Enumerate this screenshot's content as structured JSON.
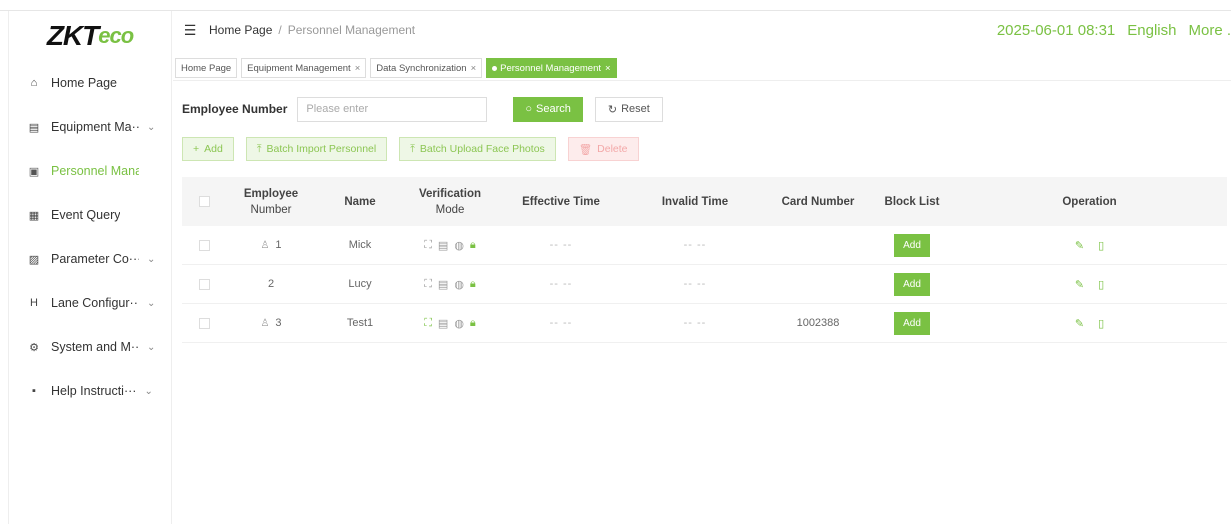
{
  "logo": {
    "main": "ZKT",
    "sub": "eco"
  },
  "sidebar": {
    "items": [
      {
        "icon": "home-icon",
        "glyph": "⌂",
        "label": "Home Page",
        "chevron": false,
        "active": false
      },
      {
        "icon": "equipment-icon",
        "glyph": "▤",
        "label": "Equipment Ma···",
        "chevron": true,
        "active": false
      },
      {
        "icon": "personnel-icon",
        "glyph": "▣",
        "label": "Personnel Manag···",
        "chevron": false,
        "active": true
      },
      {
        "icon": "event-icon",
        "glyph": "▦",
        "label": "Event Query",
        "chevron": false,
        "active": false
      },
      {
        "icon": "parameter-icon",
        "glyph": "▨",
        "label": "Parameter Co···",
        "chevron": true,
        "active": false
      },
      {
        "icon": "lane-icon",
        "glyph": "H",
        "label": "Lane Configur···",
        "chevron": true,
        "active": false
      },
      {
        "icon": "system-icon",
        "glyph": "⚙",
        "label": "System and M···",
        "chevron": true,
        "active": false
      },
      {
        "icon": "help-icon",
        "glyph": "▪",
        "label": "Help Instructi···",
        "chevron": true,
        "active": false
      }
    ]
  },
  "header": {
    "breadcrumb_home": "Home Page",
    "breadcrumb_sep": "/",
    "breadcrumb_current": "Personnel Management",
    "datetime": "2025-06-01 08:31",
    "language": "English",
    "more": "More ."
  },
  "tabs": [
    {
      "label": "Home Page",
      "closable": false,
      "active": false
    },
    {
      "label": "Equipment Management",
      "closable": true,
      "active": false
    },
    {
      "label": "Data Synchronization",
      "closable": true,
      "active": false
    },
    {
      "label": "Personnel Management",
      "closable": true,
      "active": true
    }
  ],
  "filter": {
    "label": "Employee Number",
    "placeholder": "Please enter",
    "search_label": "Search",
    "reset_label": "Reset"
  },
  "actions": {
    "add": "Add",
    "batch_import": "Batch Import Personnel",
    "batch_upload": "Batch Upload Face Photos",
    "delete": "Delete"
  },
  "table": {
    "headers": {
      "employee_number_1": "Employee",
      "employee_number_2": "Number",
      "name": "Name",
      "verification_1": "Verification",
      "verification_2": "Mode",
      "effective": "Effective Time",
      "invalid": "Invalid Time",
      "card": "Card Number",
      "block": "Block List",
      "operation": "Operation"
    },
    "rows": [
      {
        "number": "1",
        "has_person_icon": true,
        "name": "Mick",
        "effective": "-- --",
        "invalid": "-- --",
        "card": "",
        "block_btn": "Add",
        "face_active": false
      },
      {
        "number": "2",
        "has_person_icon": false,
        "name": "Lucy",
        "effective": "-- --",
        "invalid": "-- --",
        "card": "",
        "block_btn": "Add",
        "face_active": false
      },
      {
        "number": "3",
        "has_person_icon": true,
        "name": "Test1",
        "effective": "-- --",
        "invalid": "-- --",
        "card": "1002388",
        "block_btn": "Add",
        "face_active": true
      }
    ]
  },
  "colors": {
    "accent": "#7ac143",
    "delete": "#f3a8a8"
  }
}
